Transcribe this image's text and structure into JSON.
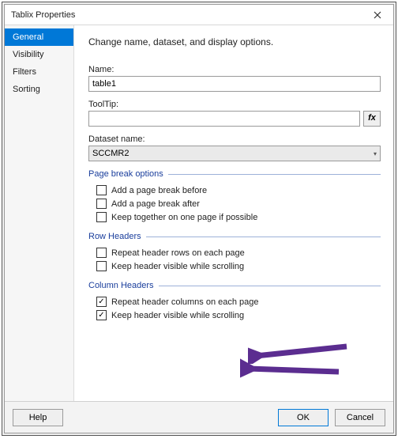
{
  "window": {
    "title": "Tablix Properties"
  },
  "sidebar": {
    "items": [
      {
        "label": "General",
        "selected": true
      },
      {
        "label": "Visibility",
        "selected": false
      },
      {
        "label": "Filters",
        "selected": false
      },
      {
        "label": "Sorting",
        "selected": false
      }
    ]
  },
  "content": {
    "intro": "Change name, dataset, and display options.",
    "name_label": "Name:",
    "name_value": "table1",
    "tooltip_label": "ToolTip:",
    "tooltip_value": "",
    "fx_label": "fx",
    "dataset_label": "Dataset name:",
    "dataset_value": "SCCMR2",
    "groups": {
      "pagebreak": {
        "title": "Page break options",
        "opts": [
          {
            "label": "Add a page break before",
            "checked": false
          },
          {
            "label": "Add a page break after",
            "checked": false
          },
          {
            "label": "Keep together on one page if possible",
            "checked": false
          }
        ]
      },
      "rowheaders": {
        "title": "Row Headers",
        "opts": [
          {
            "label": "Repeat header rows on each page",
            "checked": false
          },
          {
            "label": "Keep header visible while scrolling",
            "checked": false
          }
        ]
      },
      "colheaders": {
        "title": "Column Headers",
        "opts": [
          {
            "label": "Repeat header columns on each page",
            "checked": true
          },
          {
            "label": "Keep header visible while scrolling",
            "checked": true
          }
        ]
      }
    }
  },
  "footer": {
    "help": "Help",
    "ok": "OK",
    "cancel": "Cancel"
  },
  "annotations": {
    "arrow_color": "#5b2d90"
  }
}
